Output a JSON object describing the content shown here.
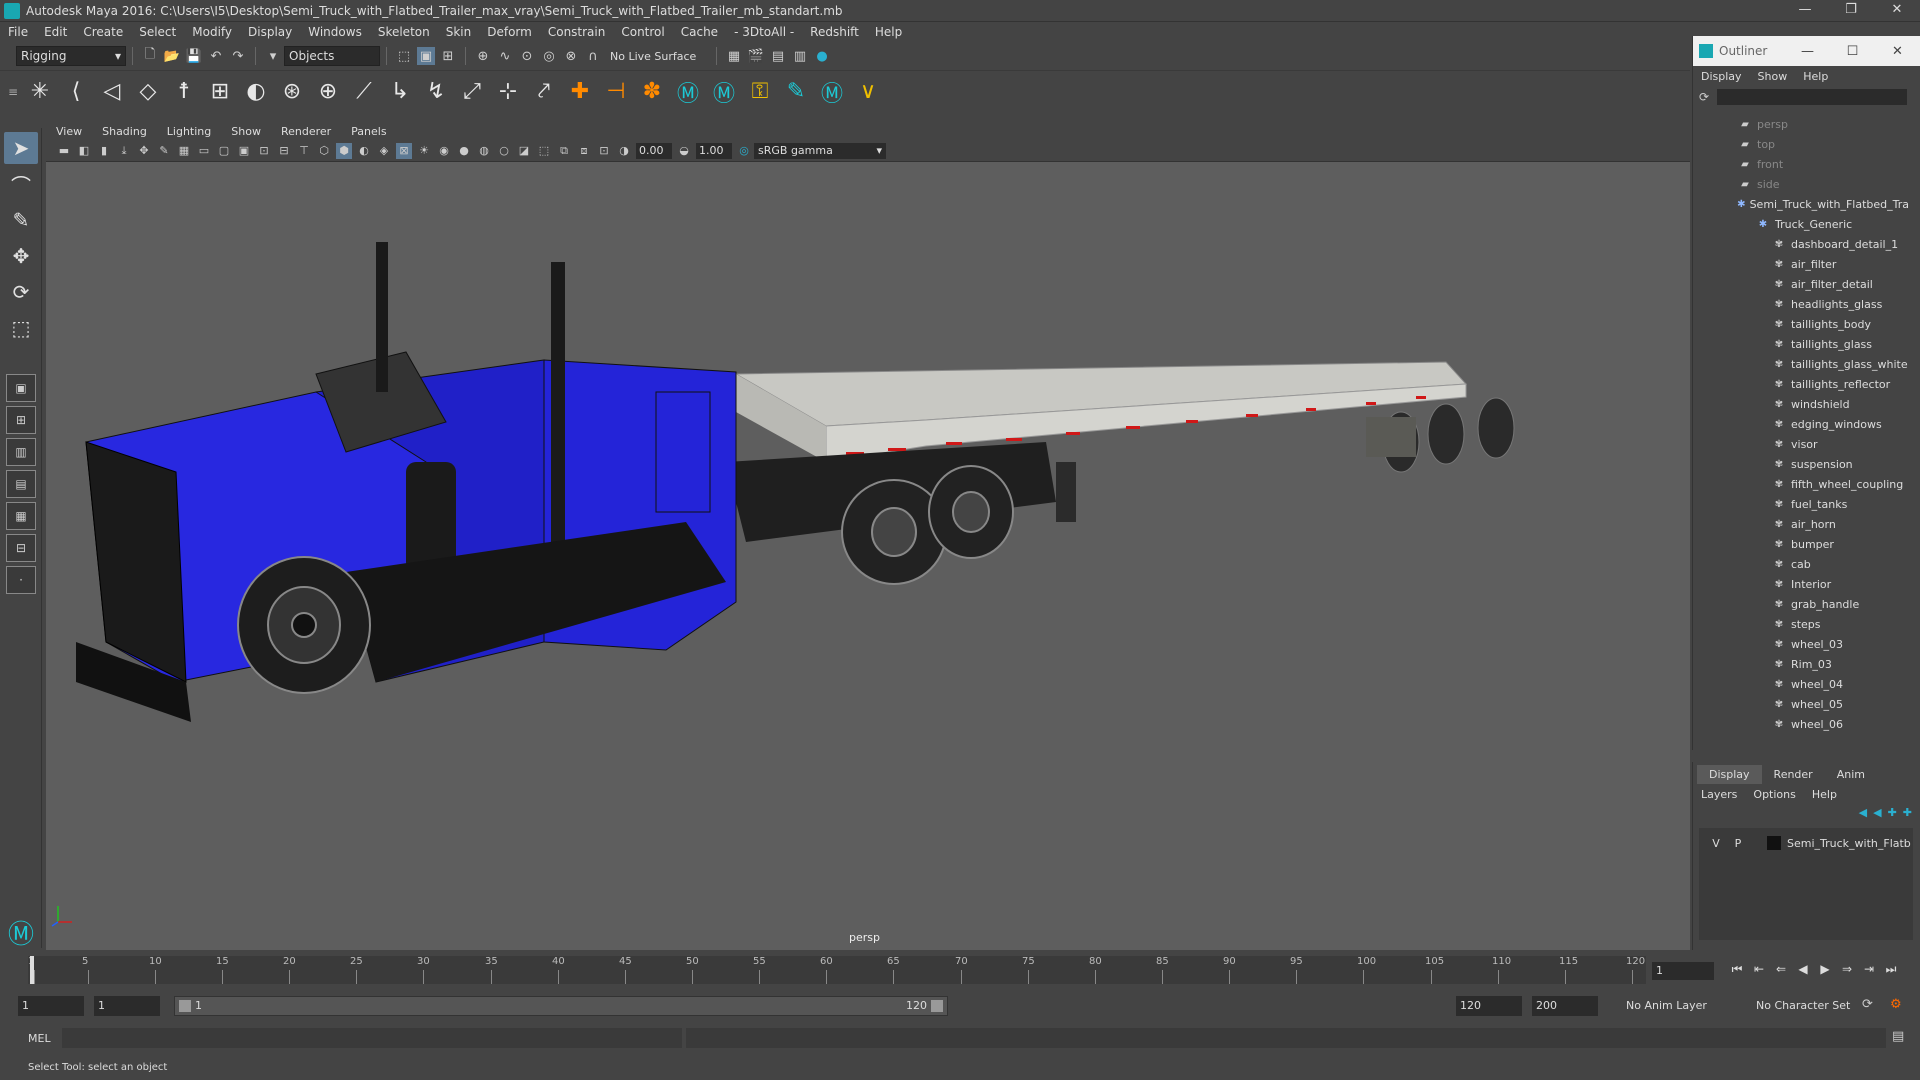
{
  "window": {
    "title": "Autodesk Maya 2016: C:\\Users\\I5\\Desktop\\Semi_Truck_with_Flatbed_Trailer_max_vray\\Semi_Truck_with_Flatbed_Trailer_mb_standart.mb",
    "minimize": "—",
    "maximize": "❐",
    "close": "✕"
  },
  "menubar": [
    "File",
    "Edit",
    "Create",
    "Select",
    "Modify",
    "Display",
    "Windows",
    "Skeleton",
    "Skin",
    "Deform",
    "Constrain",
    "Control",
    "Cache",
    "- 3DtoAll -",
    "Redshift",
    "Help"
  ],
  "statusline": {
    "menuset": "Rigging",
    "selection_mode": "Objects",
    "live_surface": "No Live Surface"
  },
  "panel_menu": [
    "View",
    "Shading",
    "Lighting",
    "Show",
    "Renderer",
    "Panels"
  ],
  "viewport_toolbar": {
    "exposure": "0.00",
    "gamma": "1.00",
    "color_space": "sRGB gamma"
  },
  "viewport": {
    "camera": "persp",
    "colors": {
      "background": "#5e5e5e",
      "cab": "#2424d8",
      "trailer": "#c9c9c4",
      "tire": "#222222"
    }
  },
  "timeline": {
    "ticks": [
      "1",
      "5",
      "10",
      "15",
      "20",
      "25",
      "30",
      "35",
      "40",
      "45",
      "50",
      "55",
      "60",
      "65",
      "70",
      "75",
      "80",
      "85",
      "90",
      "95",
      "100",
      "105",
      "110",
      "115",
      "120"
    ],
    "current_frame": "1"
  },
  "playback_icons": [
    "go-to-start-icon",
    "step-back-key-icon",
    "step-back-icon",
    "play-back-icon",
    "play-forward-icon",
    "step-forward-icon",
    "step-forward-key-icon",
    "go-to-end-icon"
  ],
  "range": {
    "start": "1",
    "playback_start": "1",
    "slider_start": "1",
    "slider_end": "120",
    "playback_end": "120",
    "end": "200",
    "anim_layer": "No Anim Layer",
    "character_set": "No Character Set"
  },
  "mel": {
    "label": "MEL"
  },
  "help_line": "Select Tool: select an object",
  "outliner": {
    "title": "Outliner",
    "menu": [
      "Display",
      "Show",
      "Help"
    ],
    "items": [
      {
        "label": "persp",
        "dim": true,
        "indent": 0
      },
      {
        "label": "top",
        "dim": true,
        "indent": 0
      },
      {
        "label": "front",
        "dim": true,
        "indent": 0
      },
      {
        "label": "side",
        "dim": true,
        "indent": 0
      },
      {
        "label": "Semi_Truck_with_Flatbed_Tra",
        "dim": false,
        "indent": 0
      },
      {
        "label": "Truck_Generic",
        "dim": false,
        "indent": 1
      },
      {
        "label": "dashboard_detail_1",
        "dim": false,
        "indent": 2
      },
      {
        "label": "air_filter",
        "dim": false,
        "indent": 2
      },
      {
        "label": "air_filter_detail",
        "dim": false,
        "indent": 2
      },
      {
        "label": "headlights_glass",
        "dim": false,
        "indent": 2
      },
      {
        "label": "taillights_body",
        "dim": false,
        "indent": 2
      },
      {
        "label": "taillights_glass",
        "dim": false,
        "indent": 2
      },
      {
        "label": "taillights_glass_white",
        "dim": false,
        "indent": 2
      },
      {
        "label": "taillights_reflector",
        "dim": false,
        "indent": 2
      },
      {
        "label": "windshield",
        "dim": false,
        "indent": 2
      },
      {
        "label": "edging_windows",
        "dim": false,
        "indent": 2
      },
      {
        "label": "visor",
        "dim": false,
        "indent": 2
      },
      {
        "label": "suspension",
        "dim": false,
        "indent": 2
      },
      {
        "label": "fifth_wheel_coupling",
        "dim": false,
        "indent": 2
      },
      {
        "label": "fuel_tanks",
        "dim": false,
        "indent": 2
      },
      {
        "label": "air_horn",
        "dim": false,
        "indent": 2
      },
      {
        "label": "bumper",
        "dim": false,
        "indent": 2
      },
      {
        "label": "cab",
        "dim": false,
        "indent": 2
      },
      {
        "label": "Interior",
        "dim": false,
        "indent": 2
      },
      {
        "label": "grab_handle",
        "dim": false,
        "indent": 2
      },
      {
        "label": "steps",
        "dim": false,
        "indent": 2
      },
      {
        "label": "wheel_03",
        "dim": false,
        "indent": 2
      },
      {
        "label": "Rim_03",
        "dim": false,
        "indent": 2
      },
      {
        "label": "wheel_04",
        "dim": false,
        "indent": 2
      },
      {
        "label": "wheel_05",
        "dim": false,
        "indent": 2
      },
      {
        "label": "wheel_06",
        "dim": false,
        "indent": 2
      }
    ]
  },
  "layer_editor": {
    "tabs": [
      "Display",
      "Render",
      "Anim"
    ],
    "menu": [
      "Layers",
      "Options",
      "Help"
    ],
    "layer": {
      "v": "V",
      "p": "P",
      "name": "Semi_Truck_with_Flatb"
    }
  }
}
